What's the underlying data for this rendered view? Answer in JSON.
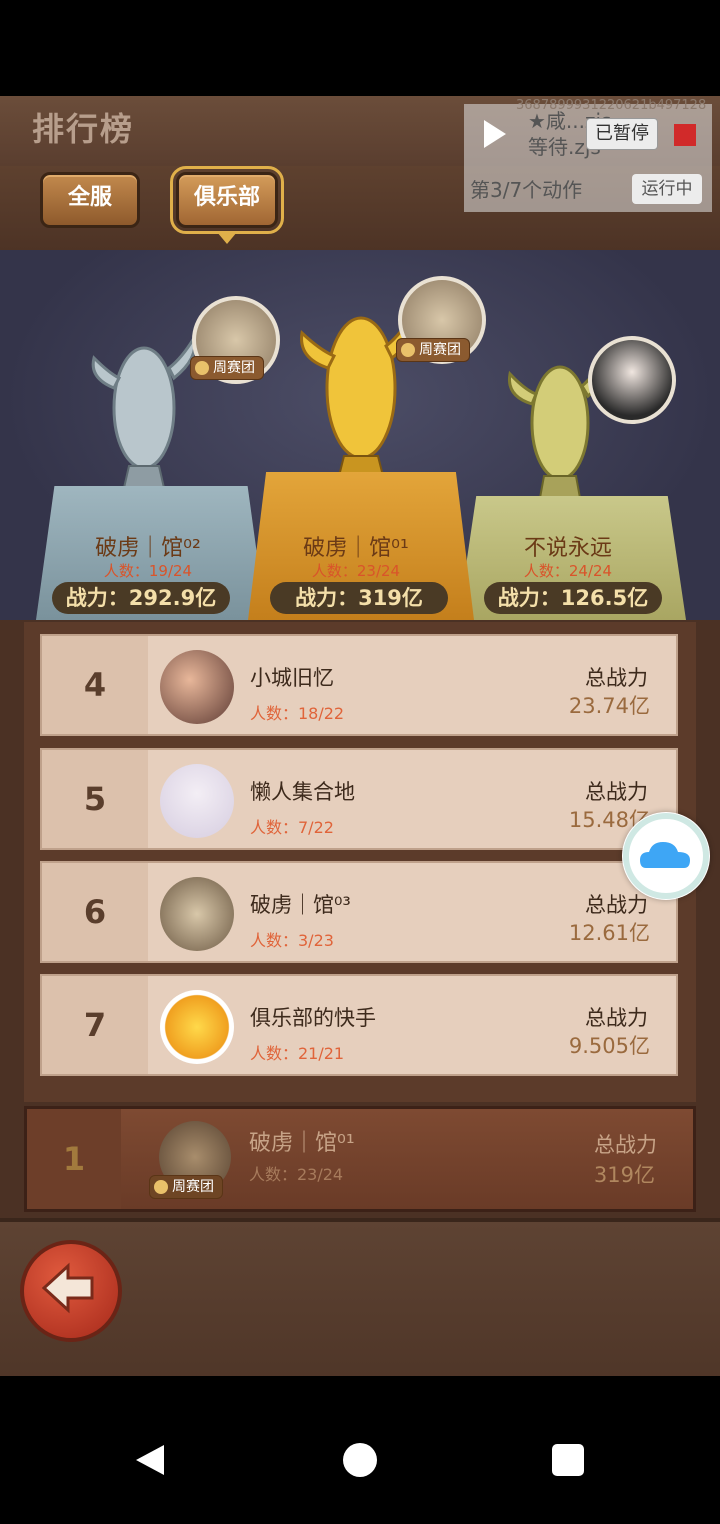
{
  "header": {
    "title": "排行榜"
  },
  "tabs": [
    {
      "label": "全服"
    },
    {
      "label": "俱乐部"
    }
  ],
  "podium": [
    {
      "rank": 2,
      "name": "破虏｜馆⁰²",
      "count": "人数：19/24",
      "power": "战力：292.9亿",
      "badge": "周赛团"
    },
    {
      "rank": 1,
      "name": "破虏｜馆⁰¹",
      "count": "人数：23/24",
      "power": "战力：319亿",
      "badge": "周赛团"
    },
    {
      "rank": 3,
      "name": "不说永远",
      "count": "人数：24/24",
      "power": "战力：126.5亿"
    }
  ],
  "list": [
    {
      "rank": "4",
      "name": "小城旧忆",
      "count": "人数：18/22",
      "power_label": "总战力",
      "power": "23.74亿"
    },
    {
      "rank": "5",
      "name": "懒人集合地",
      "count": "人数：7/22",
      "power_label": "总战力",
      "power": "15.48亿"
    },
    {
      "rank": "6",
      "name": "破虏｜馆⁰³",
      "count": "人数：3/23",
      "power_label": "总战力",
      "power": "12.61亿"
    },
    {
      "rank": "7",
      "name": "俱乐部的快手",
      "count": "人数：21/21",
      "power_label": "总战力",
      "power": "9.505亿"
    }
  ],
  "my_club": {
    "rank": "1",
    "name": "破虏｜馆⁰¹",
    "count": "人数：23/24",
    "power_label": "总战力",
    "power": "319亿",
    "badge": "周赛团"
  },
  "overlay": {
    "script_id": "3687899931220621b497128",
    "script_name_line1": "★咸...zjs",
    "script_name_line2": "等待.zjs",
    "paused": "已暂停",
    "step": "第3/7个动作",
    "status": "运行中"
  },
  "colors": {
    "gold": "#e3a53a",
    "silver": "#9fb6bf",
    "bronze": "#c9c88a",
    "accent_red": "#e0643a"
  }
}
